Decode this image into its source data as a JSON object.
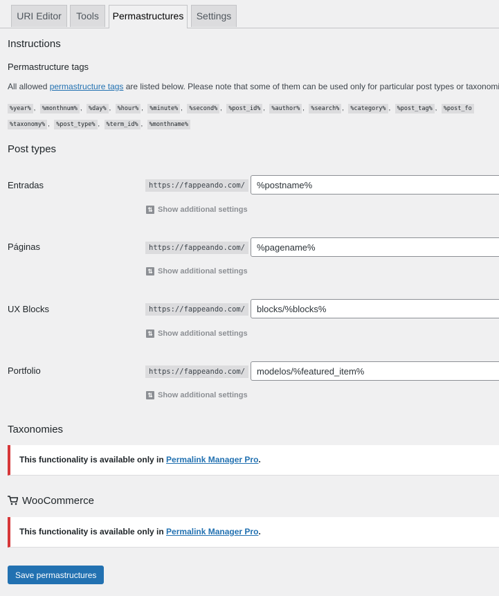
{
  "tabs": [
    {
      "label": "URI Editor"
    },
    {
      "label": "Tools"
    },
    {
      "label": "Permastructures"
    },
    {
      "label": "Settings"
    }
  ],
  "instructions": {
    "heading": "Instructions",
    "subheading": "Permastructure tags",
    "text_before": "All allowed ",
    "link": "permastructure tags",
    "text_after": " are listed below. Please note that some of them can be used only for particular post types or taxonomies.",
    "tags_row1": [
      "%year%",
      "%monthnum%",
      "%day%",
      "%hour%",
      "%minute%",
      "%second%",
      "%post_id%",
      "%author%",
      "%search%",
      "%category%",
      "%post_tag%",
      "%post_fo"
    ],
    "tags_row2": [
      "%taxonomy%",
      "%post_type%",
      "%term_id%",
      "%monthname%"
    ]
  },
  "post_types": {
    "heading": "Post types",
    "additional_settings": "Show additional settings",
    "rows": [
      {
        "label": "Entradas",
        "prefix": "https://fappeando.com/",
        "value": "%postname%"
      },
      {
        "label": "Páginas",
        "prefix": "https://fappeando.com/",
        "value": "%pagename%"
      },
      {
        "label": "UX Blocks",
        "prefix": "https://fappeando.com/",
        "value": "blocks/%blocks%"
      },
      {
        "label": "Portfolio",
        "prefix": "https://fappeando.com/",
        "value": "modelos/%featured_item%"
      }
    ]
  },
  "taxonomies": {
    "heading": "Taxonomies",
    "notice_text": "This functionality is available only in ",
    "notice_link": "Permalink Manager Pro",
    "notice_end": "."
  },
  "woocommerce": {
    "heading": "WooCommerce",
    "icon": "cart-icon",
    "notice_text": "This functionality is available only in ",
    "notice_link": "Permalink Manager Pro",
    "notice_end": "."
  },
  "save_button": "Save permastructures"
}
